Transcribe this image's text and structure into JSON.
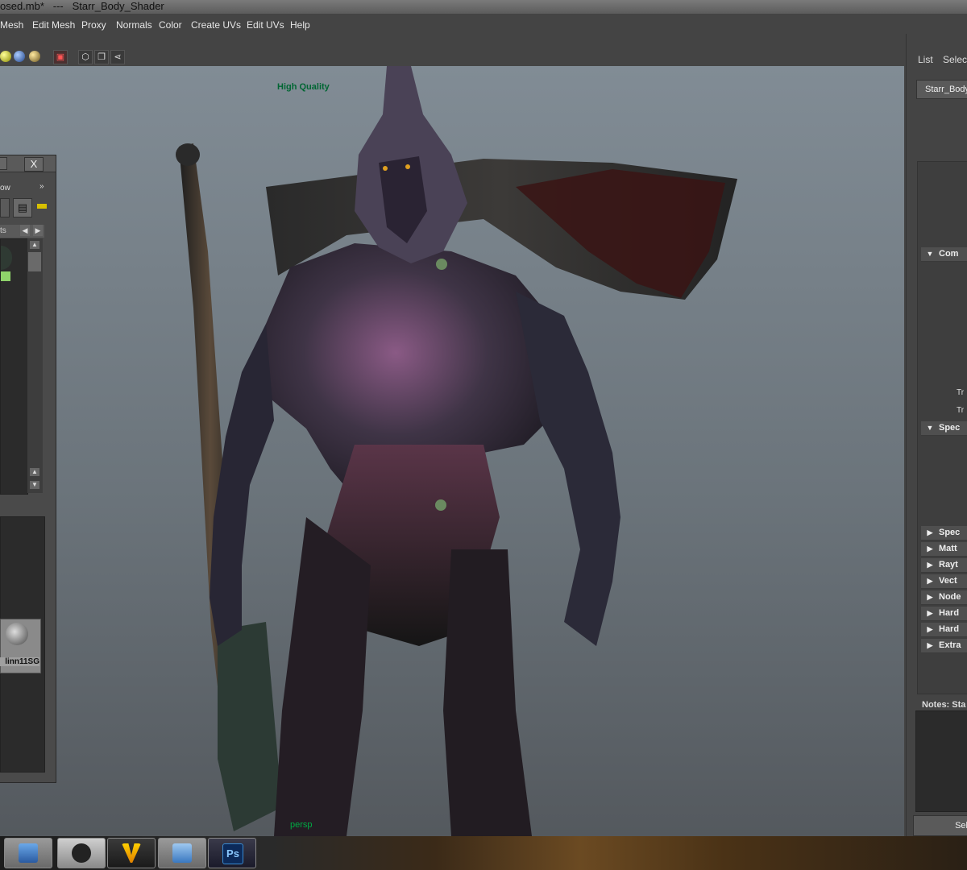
{
  "window": {
    "title": "osed.mb*   ---   Starr_Body_Shader"
  },
  "menu": [
    "Mesh",
    "Edit Mesh",
    "Proxy",
    "Normals",
    "Color",
    "Create UVs",
    "Edit UVs",
    "Help"
  ],
  "viewport": {
    "quality_label": "High Quality",
    "camera_label": "persp"
  },
  "hypershade": {
    "close_glyph": "X",
    "partial_label": "ow",
    "chevron": "»",
    "tab_label": "ts",
    "node_label": "linn11SG"
  },
  "attribute_editor": {
    "tabs": [
      "List",
      "Selecte"
    ],
    "node_name": "Starr_Body",
    "sections": [
      {
        "label": "Com",
        "expanded": true
      },
      {
        "label": "Spec",
        "expanded": true
      },
      {
        "label": "Spec",
        "expanded": false
      },
      {
        "label": "Matt",
        "expanded": false
      },
      {
        "label": "Rayt",
        "expanded": false
      },
      {
        "label": "Vect",
        "expanded": false
      },
      {
        "label": "Node",
        "expanded": false
      },
      {
        "label": "Hard",
        "expanded": false
      },
      {
        "label": "Hard",
        "expanded": false
      },
      {
        "label": "Extra",
        "expanded": false
      }
    ],
    "row_labels": [
      "Tr",
      "Tr"
    ],
    "notes_label": "Notes:  Sta",
    "select_button": "Sel"
  },
  "taskbar": {
    "ps_label": "Ps"
  },
  "colors": {
    "quality_text": "#006633",
    "viewport_top": "#818c95",
    "viewport_bottom": "#54595e"
  }
}
